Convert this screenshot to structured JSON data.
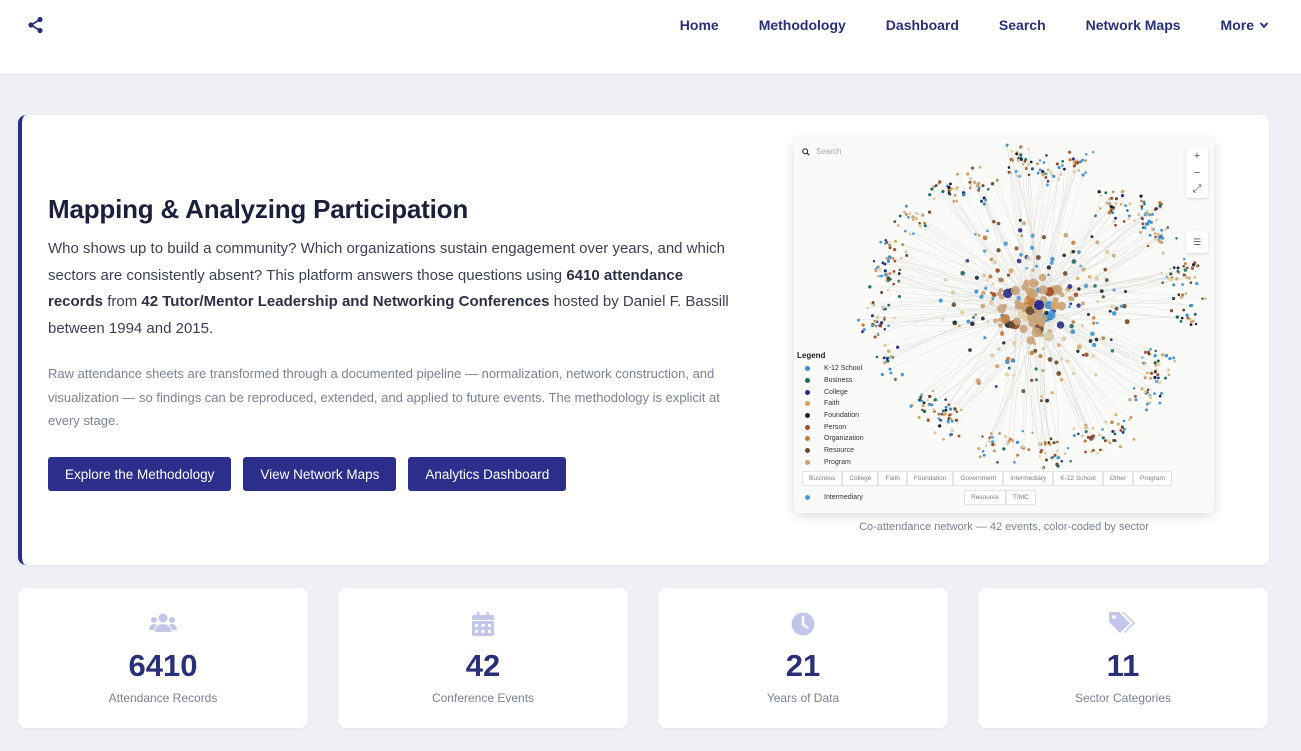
{
  "nav": {
    "items": [
      {
        "label": "Home"
      },
      {
        "label": "Methodology"
      },
      {
        "label": "Dashboard"
      },
      {
        "label": "Search"
      },
      {
        "label": "Network Maps"
      },
      {
        "label": "More"
      }
    ]
  },
  "hero": {
    "title": "Mapping & Analyzing Participation",
    "lead_1": "Who shows up to build a community? Which organizations sustain engagement over years, and which sectors are consistently absent? This platform answers those questions using ",
    "lead_b1": "6410 attendance records",
    "lead_2": " from ",
    "lead_b2": "42 Tutor/Mentor Leadership and Networking Conferences",
    "lead_3": " hosted by Daniel F. Bassill between 1994 and 2015.",
    "sub": "Raw attendance sheets are transformed through a documented pipeline — normalization, network construction, and visualization — so findings can be reproduced, extended, and applied to future events. The methodology is explicit at every stage.",
    "buttons": [
      {
        "label": "Explore the Methodology"
      },
      {
        "label": "View Network Maps"
      },
      {
        "label": "Analytics Dashboard"
      }
    ],
    "caption": "Co-attendance network — 42 events, color-coded by sector"
  },
  "network": {
    "search_placeholder": "Search",
    "legend_title": "Legend",
    "legend": [
      {
        "label": "K-12 School",
        "color": "#3a8fd0"
      },
      {
        "label": "Business",
        "color": "#1c6b63"
      },
      {
        "label": "College",
        "color": "#2b2e8a"
      },
      {
        "label": "Faith",
        "color": "#d6a55c"
      },
      {
        "label": "Foundation",
        "color": "#1d2330"
      },
      {
        "label": "Person",
        "color": "#a04a28"
      },
      {
        "label": "Organization",
        "color": "#c27a3a"
      },
      {
        "label": "Resource",
        "color": "#6b4a2a"
      },
      {
        "label": "Program",
        "color": "#c9a277"
      }
    ],
    "intermediary": {
      "label": "Intermediary",
      "color": "#4a98d8"
    },
    "filters": [
      "Business",
      "College",
      "Faith",
      "Foundation",
      "Government",
      "Intermediary",
      "K-12 School",
      "Other",
      "Program"
    ],
    "filters2": [
      "Resource",
      "T/MC"
    ]
  },
  "stats": [
    {
      "icon": "users-icon",
      "value": "6410",
      "label": "Attendance Records"
    },
    {
      "icon": "calendar-icon",
      "value": "42",
      "label": "Conference Events"
    },
    {
      "icon": "clock-icon",
      "value": "21",
      "label": "Years of Data"
    },
    {
      "icon": "tags-icon",
      "value": "11",
      "label": "Sector Categories"
    }
  ],
  "colors": {
    "brand": "#2b2e8a",
    "nav_text": "#2a2f7a",
    "icon_light": "#c3c6ea"
  }
}
